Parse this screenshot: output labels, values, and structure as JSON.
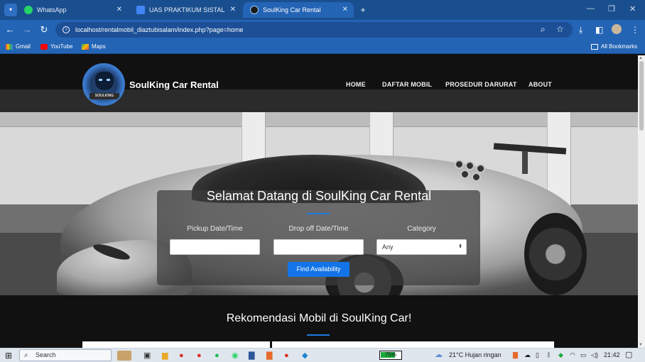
{
  "browser": {
    "tabs": [
      {
        "title": "WhatsApp",
        "active": false,
        "icon_color": "#25d366"
      },
      {
        "title": "UAS PRAKTIKUM SISTAL",
        "active": false,
        "icon_color": "#4285f4"
      },
      {
        "title": "SoulKing Car Rental",
        "active": true,
        "icon_color": "#1a1a1a"
      }
    ],
    "url": "localhost/rentalmobil_diaztubisalam/index.php?page=home",
    "bookmarks": [
      "Gmail",
      "YouTube",
      "Maps"
    ],
    "all_bookmarks": "All Bookmarks"
  },
  "site": {
    "brand": "SoulKing Car Rental",
    "logo_text": "SOULKING",
    "nav": [
      "HOME",
      "DAFTAR MOBIL",
      "PROSEDUR DARURAT",
      "ABOUT"
    ],
    "welcome": "Selamat Datang di SoulKing Car Rental",
    "form": {
      "pickup_label": "Pickup Date/Time",
      "dropoff_label": "Drop off Date/Time",
      "category_label": "Category",
      "category_value": "Any",
      "submit": "Find Availability"
    },
    "recommend_title": "Rekomendasi Mobil di SoulKing Car!",
    "accent_color": "#1274e8"
  },
  "taskbar": {
    "search": "Search",
    "battery": "75%",
    "battery_level": 0.75,
    "weather": "21°C  Hujan ringan",
    "time": "21:42"
  }
}
